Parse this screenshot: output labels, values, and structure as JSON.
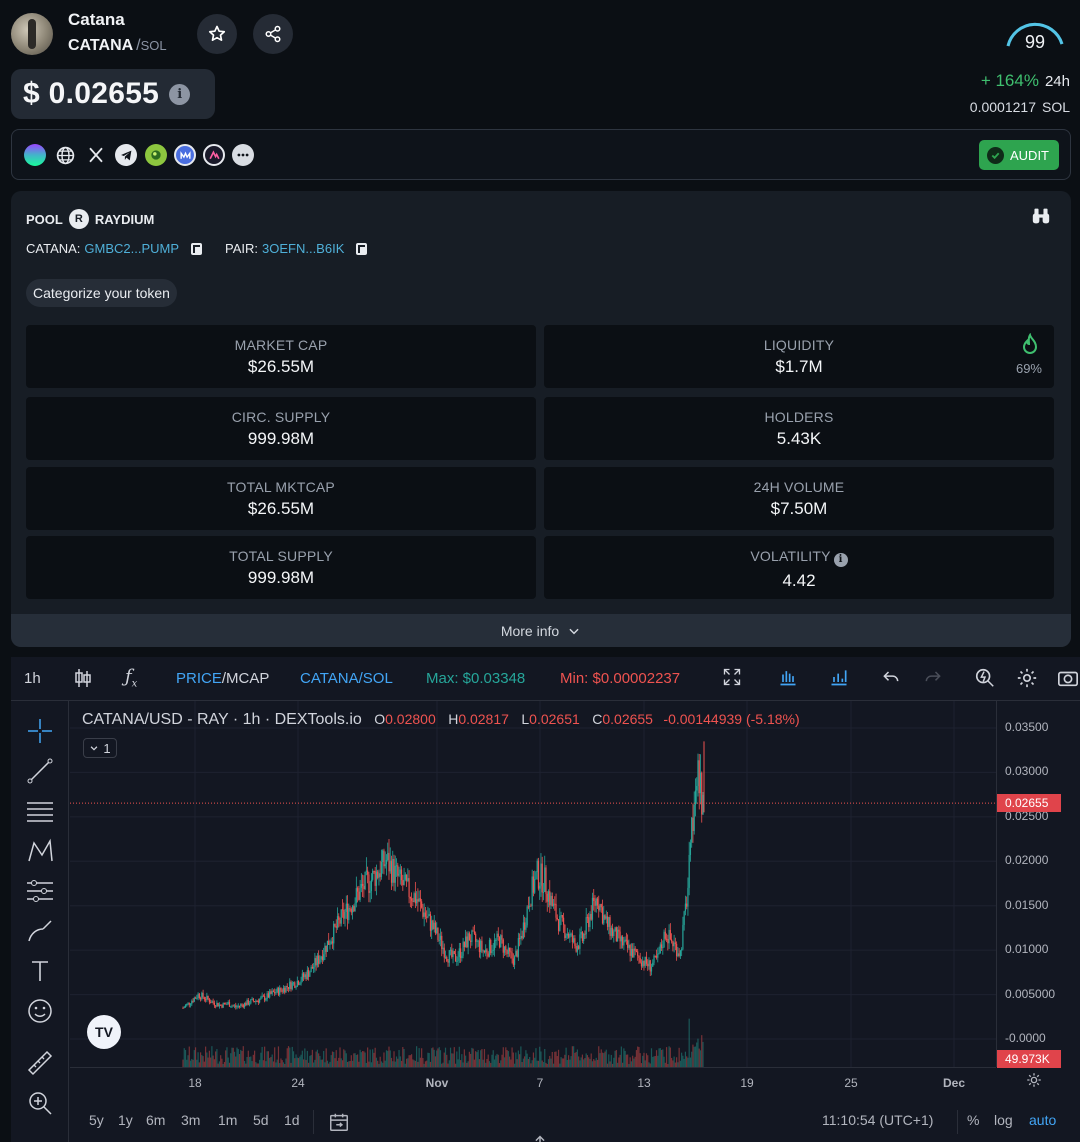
{
  "token": {
    "name": "Catana",
    "symbol": "CATANA",
    "separator": "/",
    "chain": "SOL",
    "price": "$ 0.02655",
    "score": "99",
    "change_pct": "+ 164%",
    "change_period": "24h",
    "price_native": "0.0001217",
    "price_native_unit": "SOL"
  },
  "links": {
    "audit_label": "AUDIT"
  },
  "pool": {
    "label": "POOL",
    "dex": "RAYDIUM",
    "token_addr_label": "CATANA:",
    "token_addr": "GMBC2...PUMP",
    "pair_label": "PAIR:",
    "pair_addr": "3OEFN...B6IK",
    "categorize": "Categorize your token",
    "liquidity_pct": "69%",
    "more_info": "More info",
    "stats": [
      {
        "label": "MARKET CAP",
        "value": "$26.55M"
      },
      {
        "label": "LIQUIDITY",
        "value": "$1.7M"
      },
      {
        "label": "CIRC. SUPPLY",
        "value": "999.98M"
      },
      {
        "label": "HOLDERS",
        "value": "5.43K"
      },
      {
        "label": "TOTAL MKTCAP",
        "value": "$26.55M"
      },
      {
        "label": "24H VOLUME",
        "value": "$7.50M"
      },
      {
        "label": "TOTAL SUPPLY",
        "value": "999.98M"
      },
      {
        "label": "VOLATILITY",
        "value": "4.42"
      }
    ]
  },
  "chart_toolbar": {
    "interval": "1h",
    "price": "PRICE",
    "mcap": "/MCAP",
    "pair": "CATANA/SOL",
    "max": "Max: $0.03348",
    "min": "Min: $0.00002237"
  },
  "chart_legend": {
    "title": "CATANA/USD - RAY · 1h · DEXTools.io",
    "o_label": "O",
    "o": "0.02800",
    "h_label": "H",
    "h": "0.02817",
    "l_label": "L",
    "l": "0.02651",
    "c_label": "C",
    "c": "0.02655",
    "chg": "-0.00144939 (-5.18%)",
    "collapse_count": "1"
  },
  "chart_bottom": {
    "ranges": [
      "5y",
      "1y",
      "6m",
      "3m",
      "1m",
      "5d",
      "1d"
    ],
    "time": "11:10:54 (UTC+1)",
    "pct": "%",
    "log": "log",
    "auto": "auto"
  },
  "colors": {
    "up": "#26a69a",
    "down": "#ef5350",
    "accent": "#2ea44f",
    "link": "#4fb0d9"
  },
  "chart_data": {
    "type": "candlestick",
    "y_ticks": [
      "0.03500",
      "0.03000",
      "0.02500",
      "0.02000",
      "0.01500",
      "0.01000",
      "0.005000",
      "-0.0000"
    ],
    "x_ticks": [
      "18",
      "24",
      "Nov",
      "7",
      "13",
      "19",
      "25",
      "Dec"
    ],
    "last_price_tag": "0.02655",
    "volume_tag": "49.973K",
    "close_series": [
      0.0035,
      0.0042,
      0.005,
      0.0046,
      0.0041,
      0.0038,
      0.004,
      0.0036,
      0.0039,
      0.0042,
      0.0044,
      0.0047,
      0.0052,
      0.0055,
      0.006,
      0.0064,
      0.007,
      0.0078,
      0.009,
      0.0105,
      0.012,
      0.0135,
      0.0148,
      0.016,
      0.0172,
      0.018,
      0.019,
      0.0201,
      0.0188,
      0.0175,
      0.0166,
      0.0158,
      0.0142,
      0.0128,
      0.0112,
      0.0095,
      0.009,
      0.01,
      0.0115,
      0.0108,
      0.0098,
      0.0105,
      0.0112,
      0.0096,
      0.0089,
      0.012,
      0.016,
      0.0185,
      0.0178,
      0.015,
      0.013,
      0.012,
      0.0105,
      0.0112,
      0.014,
      0.016,
      0.0132,
      0.012,
      0.011,
      0.0102,
      0.0095,
      0.0088,
      0.0082,
      0.009,
      0.012,
      0.0108,
      0.0097,
      0.017,
      0.03,
      0.0265
    ]
  }
}
